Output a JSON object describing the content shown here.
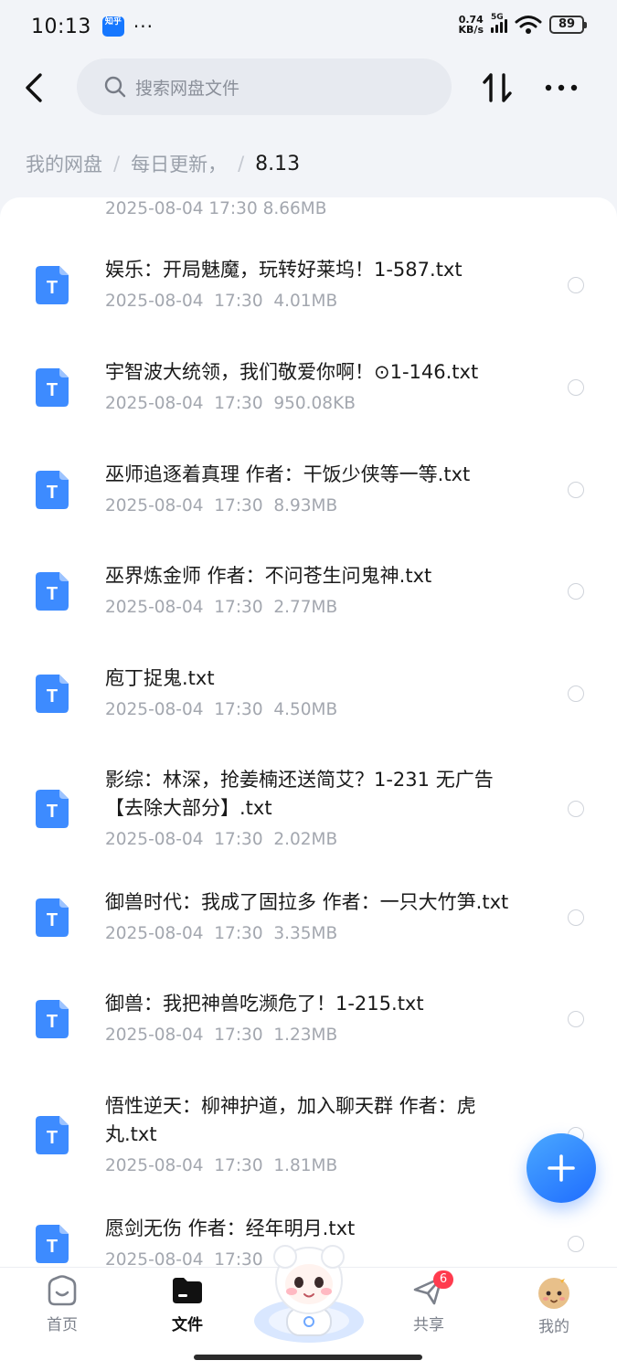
{
  "status_bar": {
    "time": "10:13",
    "app_badge": "知乎",
    "network_speed_value": "0.74",
    "network_speed_unit": "KB/s",
    "signal_label": "5G",
    "battery": "89"
  },
  "header": {
    "search_placeholder": "搜索网盘文件"
  },
  "breadcrumb": {
    "root": "我的网盘",
    "parent": "每日更新，",
    "current": "8.13"
  },
  "partial_item_meta": "2025-08-04  17:30  8.66MB",
  "files": [
    {
      "name": "娱乐：开局魅魔，玩转好莱坞！1-587.txt",
      "meta": "2025-08-04  17:30  4.01MB"
    },
    {
      "name": "宇智波大统领，我们敬爱你啊！⊙1-146.txt",
      "meta": "2025-08-04  17:30  950.08KB"
    },
    {
      "name": "巫师追逐着真理 作者：干饭少侠等一等.txt",
      "meta": "2025-08-04  17:30  8.93MB"
    },
    {
      "name": "巫界炼金师 作者：不问苍生问鬼神.txt",
      "meta": "2025-08-04  17:30  2.77MB"
    },
    {
      "name": "庖丁捉鬼.txt",
      "meta": "2025-08-04  17:30  4.50MB"
    },
    {
      "name": "影综：林深，抢姜楠还送简艾？1-231 无广告【去除大部分】.txt",
      "meta": "2025-08-04  17:30  2.02MB"
    },
    {
      "name": "御兽时代：我成了固拉多 作者：一只大竹笋.txt",
      "meta": "2025-08-04  17:30  3.35MB"
    },
    {
      "name": "御兽：我把神兽吃濒危了！1-215.txt",
      "meta": "2025-08-04  17:30  1.23MB"
    },
    {
      "name": "悟性逆天：柳神护道，加入聊天群 作者：虎丸.txt",
      "meta": "2025-08-04  17:30  1.81MB"
    },
    {
      "name": "愿剑无伤 作者：经年明月.txt",
      "meta": "2025-08-04  17:30"
    }
  ],
  "file_icon_letter": "T",
  "bottom_nav": {
    "home": "首页",
    "files": "文件",
    "share": "共享",
    "share_badge": "6",
    "mine": "我的"
  },
  "colors": {
    "accent": "#1f6dff",
    "file_icon": "#3d8bff",
    "badge": "#ff3b4e"
  }
}
